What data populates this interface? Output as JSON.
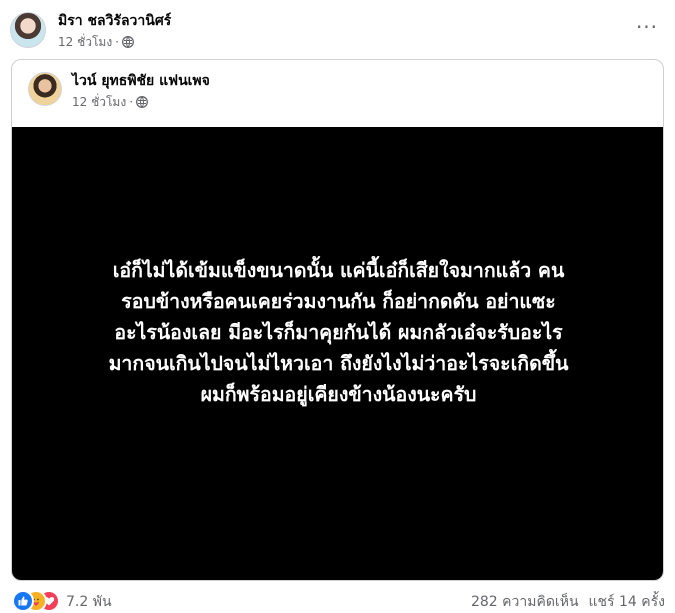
{
  "post": {
    "author": "มิรา ชลวิรัลวานิศร์",
    "time": "12 ชั่วโมง",
    "separator": "·",
    "more_label": "···"
  },
  "shared": {
    "author": "ไวน์ ยุทธพิชัย แฟนเพจ",
    "time": "12 ชั่วโมง",
    "separator": "·",
    "message_lines": [
      "เอ๋ก็ไม่ได้เข้มแข็งขนาดนั้น แค่นี้เอ๋ก็เสียใจมากแล้ว คน",
      "รอบข้างหรือคนเคยร่วมงานกัน ก็อย่ากดดัน อย่าแซะ",
      "อะไรน้องเลย มีอะไรก็มาคุยกันได้ ผมกลัวเอ๋จะรับอะไร",
      "มากจนเกินไปจนไม่ไหวเอา ถึงยังไงไม่ว่าอะไรจะเกิดขึ้น",
      "ผมก็พร้อมอยู่เคียงข้างน้องนะครับ"
    ]
  },
  "footer": {
    "reactions": [
      "like",
      "care",
      "love"
    ],
    "reaction_count": "7.2 พัน",
    "comments": "282 ความคิดเห็น",
    "shares": "แชร์ 14 ครั้ง"
  },
  "colors": {
    "like": "#1877f2",
    "care": "#f7b125",
    "love": "#f33e58",
    "muted": "#65676b"
  }
}
